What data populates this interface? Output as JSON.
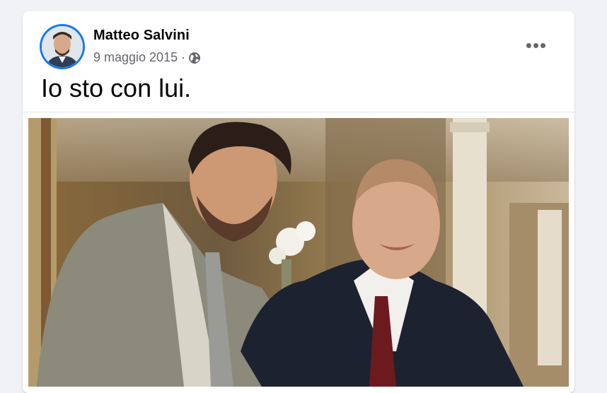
{
  "post": {
    "author": "Matteo Salvini",
    "date": "9 maggio 2015",
    "separator": "·",
    "privacy_icon": "globe-icon",
    "more_icon": "more-options-icon",
    "more_label": "•••",
    "text": "Io sto con lui."
  },
  "colors": {
    "accent": "#1877f2",
    "secondary_text": "#65676b",
    "primary_text": "#050505"
  }
}
